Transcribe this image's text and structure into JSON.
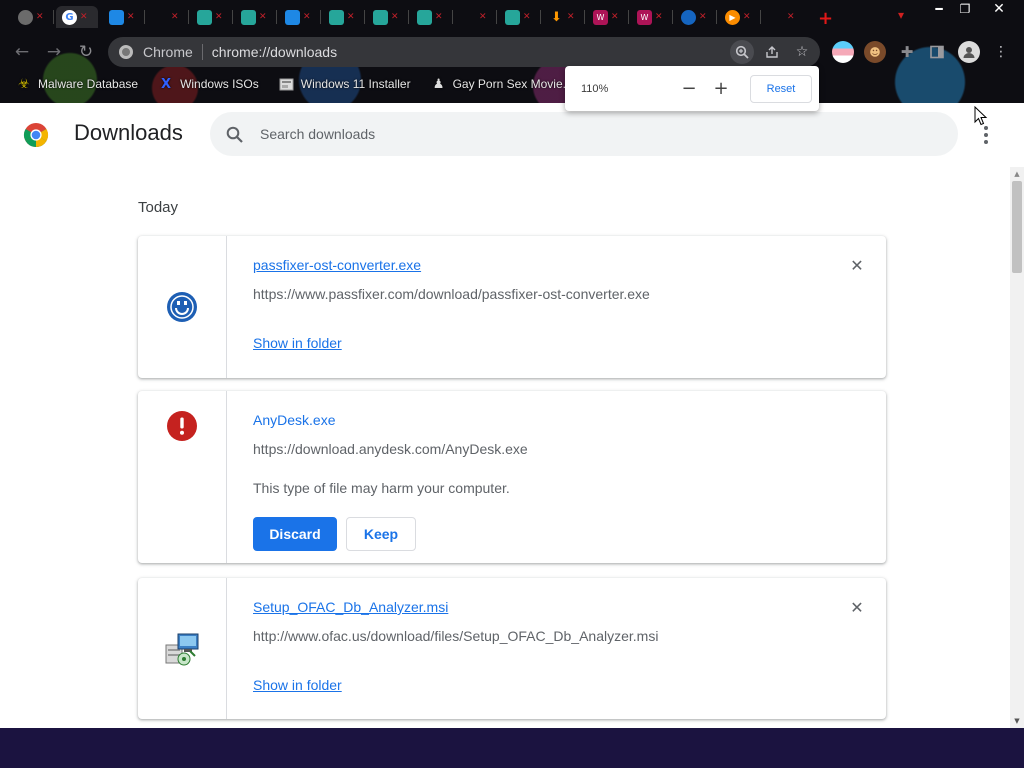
{
  "tabs": [
    {
      "icon": "chrome-tab-icon",
      "color": "#6b6b6b",
      "glyph": ""
    },
    {
      "icon": "google-tab-icon",
      "color": "#ffffff",
      "glyph": "G"
    },
    {
      "icon": "blue-tab-icon",
      "color": "#1e88e5",
      "glyph": ""
    },
    {
      "icon": "teal-tab-icon",
      "color": "#26a69a",
      "glyph": ""
    },
    {
      "icon": "teal-tab-icon",
      "color": "#26a69a",
      "glyph": ""
    },
    {
      "icon": "blue-tab-icon",
      "color": "#1e88e5",
      "glyph": ""
    },
    {
      "icon": "teal-tab-icon",
      "color": "#26a69a",
      "glyph": ""
    },
    {
      "icon": "teal-tab-icon",
      "color": "#26a69a",
      "glyph": ""
    },
    {
      "icon": "red-tab-icon",
      "color": "#c62828",
      "glyph": ""
    },
    {
      "icon": "teal-tab-icon",
      "color": "#26a69a",
      "glyph": ""
    },
    {
      "icon": "download-tab-icon",
      "color": "#e65100",
      "glyph": ""
    },
    {
      "icon": "crimson-tab-icon",
      "color": "#ad1457",
      "glyph": ""
    },
    {
      "icon": "crimson-tab-icon",
      "color": "#ad1457",
      "glyph": ""
    },
    {
      "icon": "globe-tab-icon",
      "color": "#1565c0",
      "glyph": ""
    },
    {
      "icon": "play-tab-icon",
      "color": "#fb8c00",
      "glyph": ""
    },
    {
      "icon": "active-tab-icon",
      "color": "#2a2a2e",
      "glyph": ""
    }
  ],
  "toolbar": {
    "omnibox_scheme": "Chrome",
    "omnibox_url": "chrome://downloads"
  },
  "bookmarks": [
    {
      "label": "Malware Database",
      "icon": "biohazard-icon",
      "color": "#c8b400"
    },
    {
      "label": "Windows ISOs",
      "icon": "x-icon",
      "color": "#3060ff"
    },
    {
      "label": "Windows 11 Installer",
      "icon": "installer-icon",
      "color": "#bbbbbb"
    },
    {
      "label": "Gay Porn Sex Movie...",
      "icon": "bookmark-site-icon",
      "color": "#dddddd"
    }
  ],
  "zoom": {
    "level": "110%",
    "reset_label": "Reset"
  },
  "page": {
    "title": "Downloads",
    "search_placeholder": "Search downloads",
    "date_header": "Today"
  },
  "downloads": [
    {
      "filename": "passfixer-ost-converter.exe",
      "url": "https://www.passfixer.com/download/passfixer-ost-converter.exe",
      "action": "Show in folder"
    },
    {
      "filename": "AnyDesk.exe",
      "url": "https://download.anydesk.com/AnyDesk.exe",
      "warning": "This type of file may harm your computer.",
      "discard_label": "Discard",
      "keep_label": "Keep"
    },
    {
      "filename": "Setup_OFAC_Db_Analyzer.msi",
      "url": "http://www.ofac.us/download/files/Setup_OFAC_Db_Analyzer.msi",
      "action": "Show in folder"
    }
  ],
  "colors": {
    "accent": "#1a73e8",
    "danger": "#c5221f",
    "page_bg": "#ffffff",
    "outer_bg": "#1b1340"
  }
}
